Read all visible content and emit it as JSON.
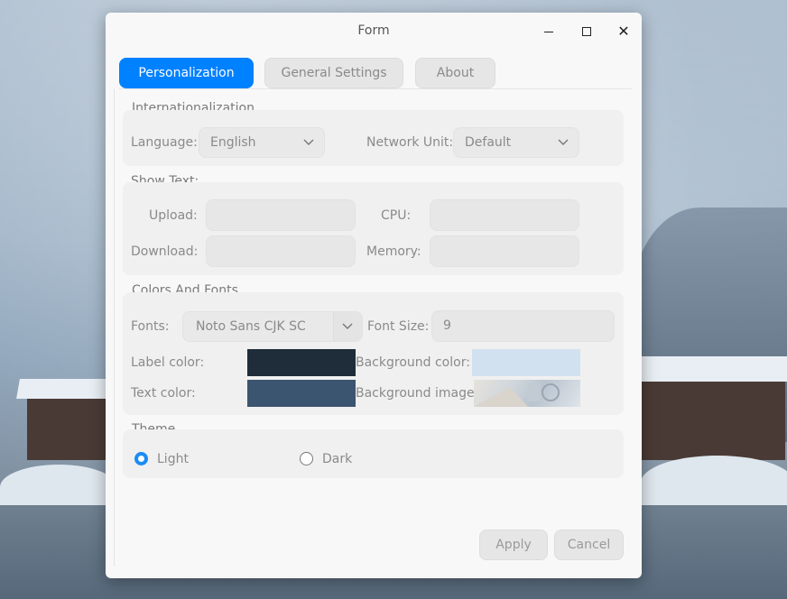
{
  "window": {
    "title": "Form"
  },
  "tabs": [
    {
      "label": "Personalization",
      "active": true
    },
    {
      "label": "General Settings",
      "active": false
    },
    {
      "label": "About",
      "active": false
    }
  ],
  "internationalization": {
    "title": "Internationalization",
    "language_label": "Language:",
    "language_value": "English",
    "network_unit_label": "Network Unit:",
    "network_unit_value": "Default"
  },
  "show_text": {
    "title": "Show Text:",
    "upload_label": "Upload:",
    "upload_value": "",
    "cpu_label": "CPU:",
    "cpu_value": "",
    "download_label": "Download:",
    "download_value": "",
    "memory_label": "Memory:",
    "memory_value": ""
  },
  "colors_fonts": {
    "title": "Colors And Fonts",
    "fonts_label": "Fonts:",
    "fonts_value": "Noto Sans CJK SC",
    "font_size_label": "Font Size:",
    "font_size_value": "9",
    "label_color_label": "Label color:",
    "label_color": "#1f2d3a",
    "text_color_label": "Text color:",
    "text_color": "#3b5470",
    "background_color_label": "Background color:",
    "background_color": "#d2e1ef",
    "background_image_label": "Background image:"
  },
  "theme": {
    "title": "Theme",
    "options": [
      {
        "label": "Light",
        "selected": true
      },
      {
        "label": "Dark",
        "selected": false
      }
    ]
  },
  "actions": {
    "apply_label": "Apply",
    "cancel_label": "Cancel"
  },
  "colors": {
    "accent": "#0081ff"
  }
}
